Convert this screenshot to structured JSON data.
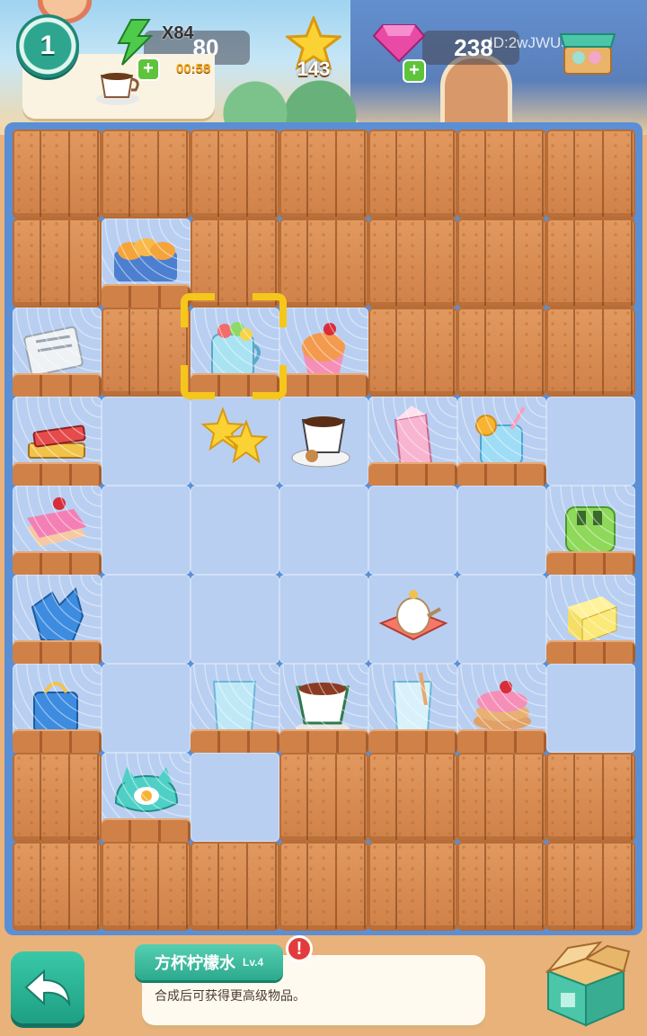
{
  "hud": {
    "level": "1",
    "energy_multiplier": "X84",
    "energy": "80",
    "energy_timer": "00:58",
    "stars": "143",
    "gems": "238",
    "player_id": "ID:2wJWUSKW",
    "plus": "+",
    "icons": [
      "level-badge-icon",
      "energy-bolt-icon",
      "star-icon",
      "gem-icon",
      "shop-icon",
      "coffee-cup-icon"
    ]
  },
  "board": {
    "cols": 7,
    "rows": 9,
    "open_cells": [
      "2,2",
      "3,2",
      "3,3",
      "4,3",
      "5,3",
      "6,3",
      "2,4",
      "3,4",
      "4,4",
      "5,4",
      "6,4",
      "2,5",
      "3,5",
      "4,5",
      "5,5",
      "6,5",
      "2,6",
      "3,6",
      "4,6",
      "5,6",
      "6,6",
      "2,7",
      "1,3",
      "1,4",
      "1,5",
      "1,6"
    ],
    "items": [
      {
        "name": "bread-basket-icon",
        "col": 1,
        "row": 1,
        "webbed": true
      },
      {
        "name": "newspaper-icon",
        "col": 0,
        "row": 2,
        "webbed": true
      },
      {
        "name": "lemonade-jar-icon",
        "col": 2,
        "row": 2,
        "webbed": true,
        "selected": true
      },
      {
        "name": "cupcake-icon",
        "col": 3,
        "row": 2,
        "webbed": true
      },
      {
        "name": "books-icon",
        "col": 0,
        "row": 3,
        "webbed": true
      },
      {
        "name": "double-star-icon",
        "col": 2,
        "row": 3,
        "webbed": false
      },
      {
        "name": "coffee-and-cookies-icon",
        "col": 3,
        "row": 3,
        "webbed": false
      },
      {
        "name": "milk-carton-icon",
        "col": 4,
        "row": 3,
        "webbed": true
      },
      {
        "name": "orange-juice-icon",
        "col": 5,
        "row": 3,
        "webbed": true
      },
      {
        "name": "cake-slice-icon",
        "col": 0,
        "row": 4,
        "webbed": true
      },
      {
        "name": "toaster-icon",
        "col": 6,
        "row": 4,
        "webbed": true
      },
      {
        "name": "blue-wrap-icon",
        "col": 0,
        "row": 5,
        "webbed": true
      },
      {
        "name": "teapot-set-icon",
        "col": 4,
        "row": 5,
        "webbed": false
      },
      {
        "name": "butter-icon",
        "col": 6,
        "row": 5,
        "webbed": true
      },
      {
        "name": "blue-bag-icon",
        "col": 0,
        "row": 6,
        "webbed": true
      },
      {
        "name": "water-glass-icon",
        "col": 2,
        "row": 6,
        "webbed": true
      },
      {
        "name": "tea-cup-icon",
        "col": 3,
        "row": 6,
        "webbed": true
      },
      {
        "name": "milk-glass-icon",
        "col": 4,
        "row": 6,
        "webbed": true
      },
      {
        "name": "pancake-stack-icon",
        "col": 5,
        "row": 6,
        "webbed": true
      },
      {
        "name": "cat-egg-plate-icon",
        "col": 1,
        "row": 7,
        "webbed": true
      }
    ]
  },
  "item_info": {
    "title": "方杯柠檬水",
    "level": "Lv.4",
    "alert": "!",
    "description": "合成后可获得更高级物品。"
  },
  "buttons": {
    "back": "back-arrow-icon",
    "storage": "storage-box-icon"
  },
  "colors": {
    "board_blue": "#5a8fd6",
    "cell_blue": "#b9cff1",
    "crate_orange": "#d88a52",
    "teal": "#2da98d",
    "selector_yellow": "#f5c71a",
    "gem_pink": "#e94aa6",
    "energy_green": "#4ecb4a"
  }
}
